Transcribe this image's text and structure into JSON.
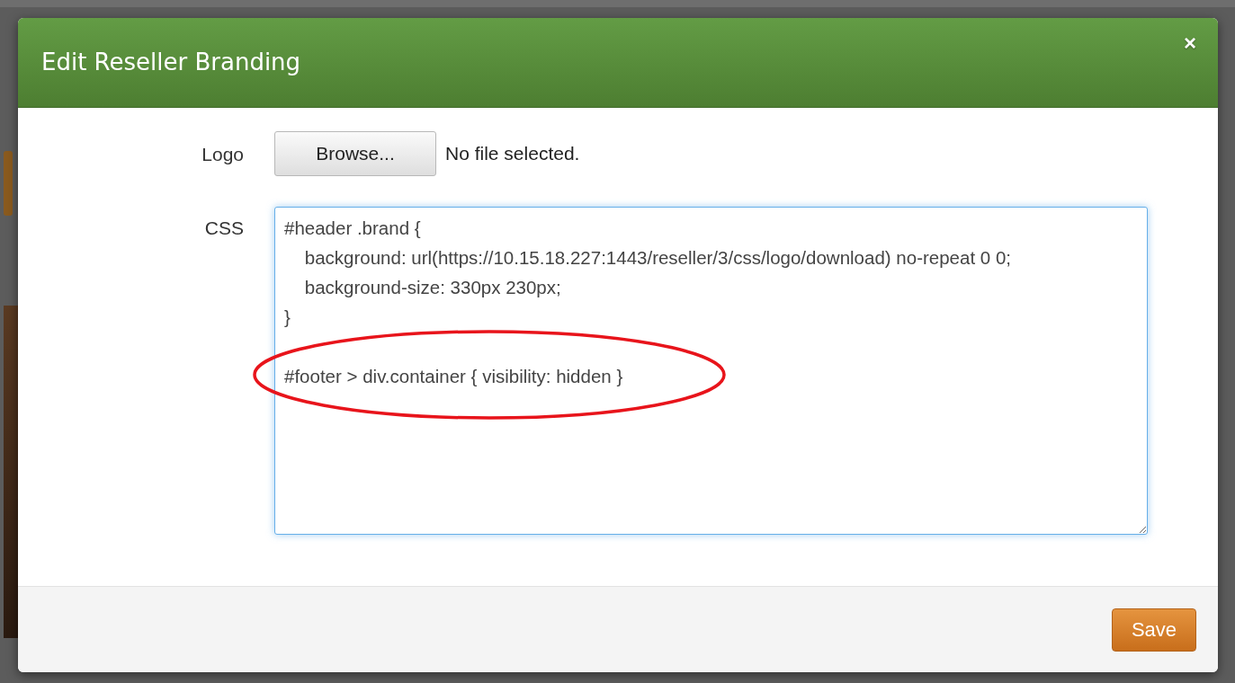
{
  "dialog": {
    "title": "Edit Reseller Branding",
    "close": "×"
  },
  "fields": [
    {
      "kind": "file",
      "label": "Logo",
      "button": "Browse...",
      "status": "No file selected."
    },
    {
      "kind": "textarea",
      "label": "CSS",
      "value": "#header .brand {\n    background: url(https://10.15.18.227:1443/reseller/3/css/logo/download) no-repeat 0 0;\n    background-size: 330px 230px;\n}\n\n#footer > div.container { visibility: hidden }"
    }
  ],
  "footer": {
    "buttons": [
      "Save"
    ]
  }
}
